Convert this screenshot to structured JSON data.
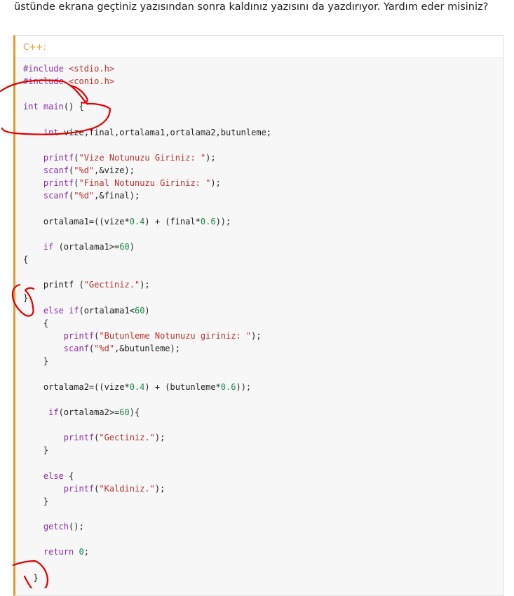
{
  "post": {
    "text": "üstünde ekrana geçtiniz yazısından sonra kaldınız yazısını da yazdırıyor. Yardım eder misiniz?"
  },
  "code_block": {
    "language_label": "C++:",
    "lines": [
      [
        {
          "t": "kw",
          "v": "#include "
        },
        {
          "t": "str",
          "v": "<stdio.h>"
        }
      ],
      [
        {
          "t": "kw",
          "v": "#include "
        },
        {
          "t": "str",
          "v": "<conio.h>"
        }
      ],
      [],
      [
        {
          "t": "kw",
          "v": "int"
        },
        {
          "t": "txt",
          "v": " "
        },
        {
          "t": "kw",
          "v": "main"
        },
        {
          "t": "txt",
          "v": "() {"
        }
      ],
      [],
      [
        {
          "t": "txt",
          "v": "    "
        },
        {
          "t": "kw",
          "v": "int"
        },
        {
          "t": "txt",
          "v": " vize,final,ortalama1,ortalama2,butunleme;"
        }
      ],
      [],
      [
        {
          "t": "txt",
          "v": "    "
        },
        {
          "t": "kw",
          "v": "printf"
        },
        {
          "t": "txt",
          "v": "("
        },
        {
          "t": "str",
          "v": "\"Vize Notunuzu Giriniz: \""
        },
        {
          "t": "txt",
          "v": ");"
        }
      ],
      [
        {
          "t": "txt",
          "v": "    "
        },
        {
          "t": "kw",
          "v": "scanf"
        },
        {
          "t": "txt",
          "v": "("
        },
        {
          "t": "str",
          "v": "\"%d\""
        },
        {
          "t": "txt",
          "v": ",&vize);"
        }
      ],
      [
        {
          "t": "txt",
          "v": "    "
        },
        {
          "t": "kw",
          "v": "printf"
        },
        {
          "t": "txt",
          "v": "("
        },
        {
          "t": "str",
          "v": "\"Final Notunuzu Giriniz: \""
        },
        {
          "t": "txt",
          "v": ");"
        }
      ],
      [
        {
          "t": "txt",
          "v": "    "
        },
        {
          "t": "kw",
          "v": "scanf"
        },
        {
          "t": "txt",
          "v": "("
        },
        {
          "t": "str",
          "v": "\"%d\""
        },
        {
          "t": "txt",
          "v": ",&final);"
        }
      ],
      [],
      [
        {
          "t": "txt",
          "v": "    ortalama1=((vize*"
        },
        {
          "t": "num",
          "v": "0.4"
        },
        {
          "t": "txt",
          "v": ") + (final*"
        },
        {
          "t": "num",
          "v": "0.6"
        },
        {
          "t": "txt",
          "v": "));"
        }
      ],
      [],
      [
        {
          "t": "txt",
          "v": "    "
        },
        {
          "t": "kw",
          "v": "if"
        },
        {
          "t": "txt",
          "v": " (ortalama1>="
        },
        {
          "t": "num",
          "v": "60"
        },
        {
          "t": "txt",
          "v": ")"
        }
      ],
      [
        {
          "t": "txt",
          "v": "{"
        }
      ],
      [],
      [
        {
          "t": "txt",
          "v": "    printf ("
        },
        {
          "t": "str",
          "v": "\"Gectiniz.\""
        },
        {
          "t": "txt",
          "v": ");"
        }
      ],
      [
        {
          "t": "txt",
          "v": "}"
        }
      ],
      [
        {
          "t": "txt",
          "v": "    "
        },
        {
          "t": "kw",
          "v": "else if"
        },
        {
          "t": "txt",
          "v": "(ortalama1<"
        },
        {
          "t": "num",
          "v": "60"
        },
        {
          "t": "txt",
          "v": ")"
        }
      ],
      [
        {
          "t": "txt",
          "v": "    {"
        }
      ],
      [
        {
          "t": "txt",
          "v": "        "
        },
        {
          "t": "kw",
          "v": "printf"
        },
        {
          "t": "txt",
          "v": "("
        },
        {
          "t": "str",
          "v": "\"Butunleme Notunuzu giriniz: \""
        },
        {
          "t": "txt",
          "v": ");"
        }
      ],
      [
        {
          "t": "txt",
          "v": "        "
        },
        {
          "t": "kw",
          "v": "scanf"
        },
        {
          "t": "txt",
          "v": "("
        },
        {
          "t": "str",
          "v": "\"%d\""
        },
        {
          "t": "txt",
          "v": ",&butunleme);"
        }
      ],
      [
        {
          "t": "txt",
          "v": "    }"
        }
      ],
      [],
      [
        {
          "t": "txt",
          "v": "    ortalama2=((vize*"
        },
        {
          "t": "num",
          "v": "0.4"
        },
        {
          "t": "txt",
          "v": ") + (butunleme*"
        },
        {
          "t": "num",
          "v": "0.6"
        },
        {
          "t": "txt",
          "v": "));"
        }
      ],
      [],
      [
        {
          "t": "txt",
          "v": "     "
        },
        {
          "t": "kw",
          "v": "if"
        },
        {
          "t": "txt",
          "v": "(ortalama2>="
        },
        {
          "t": "num",
          "v": "60"
        },
        {
          "t": "txt",
          "v": "){"
        }
      ],
      [],
      [
        {
          "t": "txt",
          "v": "        "
        },
        {
          "t": "kw",
          "v": "printf"
        },
        {
          "t": "txt",
          "v": "("
        },
        {
          "t": "str",
          "v": "\"Gectiniz.\""
        },
        {
          "t": "txt",
          "v": ");"
        }
      ],
      [
        {
          "t": "txt",
          "v": "    }"
        }
      ],
      [],
      [
        {
          "t": "txt",
          "v": "    "
        },
        {
          "t": "kw",
          "v": "else"
        },
        {
          "t": "txt",
          "v": " {"
        }
      ],
      [
        {
          "t": "txt",
          "v": "        "
        },
        {
          "t": "kw",
          "v": "printf"
        },
        {
          "t": "txt",
          "v": "("
        },
        {
          "t": "str",
          "v": "\"Kaldiniz.\""
        },
        {
          "t": "txt",
          "v": ");"
        }
      ],
      [
        {
          "t": "txt",
          "v": "    }"
        }
      ],
      [],
      [
        {
          "t": "txt",
          "v": "    "
        },
        {
          "t": "kw",
          "v": "getch"
        },
        {
          "t": "txt",
          "v": "();"
        }
      ],
      [],
      [
        {
          "t": "txt",
          "v": "    "
        },
        {
          "t": "kw",
          "v": "return"
        },
        {
          "t": "txt",
          "v": " "
        },
        {
          "t": "num",
          "v": "0"
        },
        {
          "t": "txt",
          "v": ";"
        }
      ],
      [],
      [
        {
          "t": "txt",
          "v": "  }"
        }
      ]
    ]
  },
  "colors": {
    "accent": "#e8972e",
    "keyword": "#8b2fa0",
    "string": "#b8322f",
    "number": "#1f8a4a",
    "annotation": "#e00000"
  }
}
